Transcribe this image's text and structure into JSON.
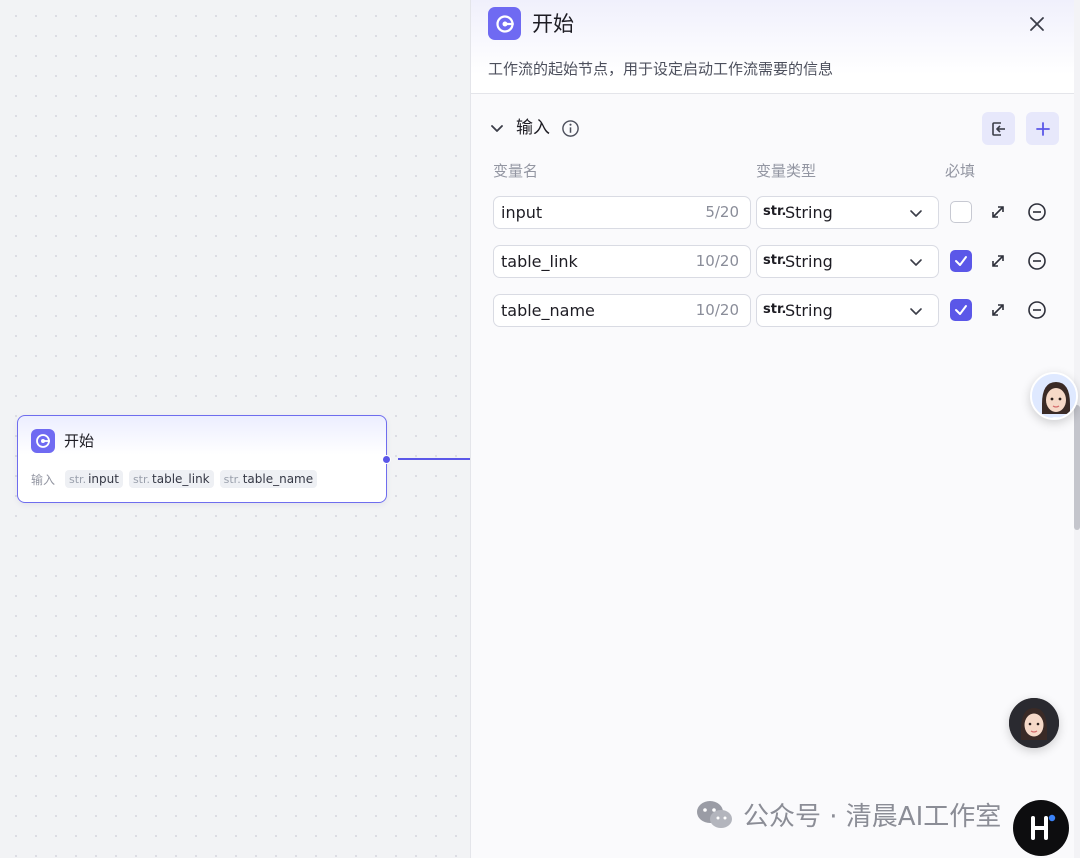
{
  "canvas": {
    "node": {
      "title": "开始",
      "inputs_label": "输入",
      "inputs": [
        {
          "type": "str.",
          "name": "input"
        },
        {
          "type": "str.",
          "name": "table_link"
        },
        {
          "type": "str.",
          "name": "table_name"
        }
      ]
    }
  },
  "panel": {
    "title": "开始",
    "description": "工作流的起始节点，用于设定启动工作流需要的信息",
    "section": {
      "title": "输入",
      "columns": {
        "name": "变量名",
        "type": "变量类型",
        "required": "必填"
      },
      "rows": [
        {
          "name": "input",
          "count": "5/20",
          "type_prefix": "str.",
          "type": "String",
          "required": false
        },
        {
          "name": "table_link",
          "count": "10/20",
          "type_prefix": "str.",
          "type": "String",
          "required": true
        },
        {
          "name": "table_name",
          "count": "10/20",
          "type_prefix": "str.",
          "type": "String",
          "required": true
        }
      ]
    }
  },
  "watermark": {
    "text": "公众号 · 清晨AI工作室"
  },
  "colors": {
    "accent": "#5b57e8",
    "node_icon": "#6f6af2",
    "button_bg": "#e7e8fb"
  },
  "icons": [
    "start-icon",
    "close-icon",
    "chevron-down-icon",
    "info-icon",
    "import-icon",
    "plus-icon",
    "expand-icon",
    "minus-circle-icon",
    "check-icon",
    "wechat-icon",
    "k-logo-icon"
  ]
}
